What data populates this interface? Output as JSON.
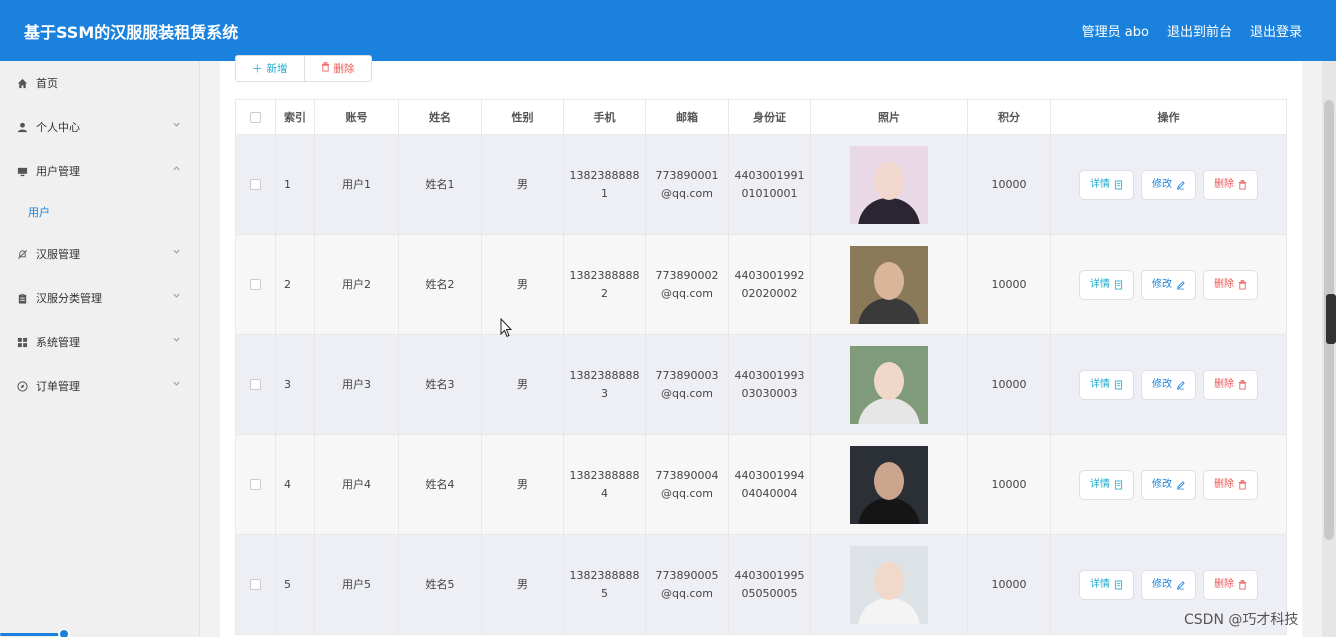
{
  "header": {
    "title": "基于SSM的汉服服装租赁系统",
    "admin": "管理员 abo",
    "back_front": "退出到前台",
    "logout": "退出登录"
  },
  "sidebar": {
    "items": [
      {
        "label": "首页",
        "icon": "home-icon"
      },
      {
        "label": "个人中心",
        "icon": "user-icon"
      },
      {
        "label": "用户管理",
        "icon": "monitor-icon"
      },
      {
        "label": "汉服管理",
        "icon": "bell-off-icon"
      },
      {
        "label": "汉服分类管理",
        "icon": "clipboard-icon"
      },
      {
        "label": "系统管理",
        "icon": "grid-icon"
      },
      {
        "label": "订单管理",
        "icon": "compass-icon"
      }
    ],
    "submenu": {
      "label": "用户"
    }
  },
  "toolbar": {
    "add_label": "新增",
    "delete_label": "删除"
  },
  "table": {
    "headers": [
      "索引",
      "账号",
      "姓名",
      "性别",
      "手机",
      "邮箱",
      "身份证",
      "照片",
      "积分",
      "操作"
    ],
    "rows": [
      {
        "index": "1",
        "account": "用户1",
        "name": "姓名1",
        "gender": "男",
        "phone_a": "1382388888",
        "phone_b": "1",
        "email_a": "773890001",
        "email_b": "@qq.com",
        "id_a": "4403001991",
        "id_b": "01010001",
        "points": "10000"
      },
      {
        "index": "2",
        "account": "用户2",
        "name": "姓名2",
        "gender": "男",
        "phone_a": "1382388888",
        "phone_b": "2",
        "email_a": "773890002",
        "email_b": "@qq.com",
        "id_a": "4403001992",
        "id_b": "02020002",
        "points": "10000"
      },
      {
        "index": "3",
        "account": "用户3",
        "name": "姓名3",
        "gender": "男",
        "phone_a": "1382388888",
        "phone_b": "3",
        "email_a": "773890003",
        "email_b": "@qq.com",
        "id_a": "4403001993",
        "id_b": "03030003",
        "points": "10000"
      },
      {
        "index": "4",
        "account": "用户4",
        "name": "姓名4",
        "gender": "男",
        "phone_a": "1382388888",
        "phone_b": "4",
        "email_a": "773890004",
        "email_b": "@qq.com",
        "id_a": "4403001994",
        "id_b": "04040004",
        "points": "10000"
      },
      {
        "index": "5",
        "account": "用户5",
        "name": "姓名5",
        "gender": "男",
        "phone_a": "1382388888",
        "phone_b": "5",
        "email_a": "773890005",
        "email_b": "@qq.com",
        "id_a": "4403001995",
        "id_b": "05050005",
        "points": "10000"
      }
    ],
    "actions": {
      "detail": "详情",
      "edit": "修改",
      "remove": "删除"
    }
  },
  "watermark": "CSDN @巧才科技",
  "colors": {
    "primary": "#1a82dd",
    "danger": "#e55555",
    "info": "#1aaacc"
  }
}
